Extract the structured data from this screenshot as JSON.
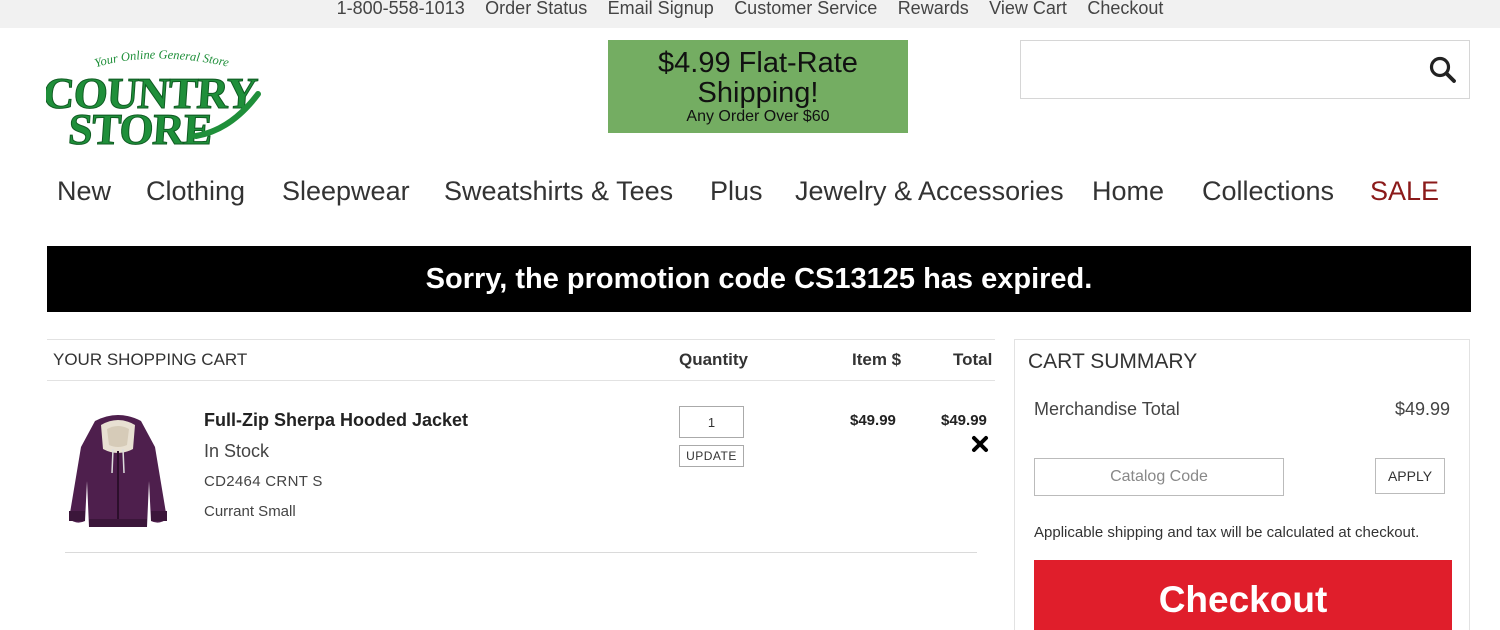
{
  "topbar": {
    "links": [
      "1-800-558-1013",
      "Order Status",
      "Email Signup",
      "Customer Service",
      "Rewards",
      "View Cart",
      "Checkout"
    ]
  },
  "logo": {
    "tagline": "Your Online General Store",
    "line1": "COUNTRY",
    "line2": "STORE",
    "color": "#1f8f3a"
  },
  "promo": {
    "line1": "$4.99 Flat-Rate",
    "line2": "Shipping!",
    "line3": "Any Order Over $60",
    "color": "#74ad62"
  },
  "search": {
    "placeholder": "",
    "icon": "search-icon"
  },
  "nav": {
    "items": [
      "New",
      "Clothing",
      "Sleepwear",
      "Sweatshirts & Tees",
      "Plus",
      "Jewelry & Accessories",
      "Home",
      "Collections",
      "SALE"
    ],
    "sale_color": "#8b1a1a"
  },
  "alert": {
    "message": "Sorry, the promotion code CS13125 has expired."
  },
  "cart": {
    "title": "YOUR SHOPPING CART",
    "col_quantity": "Quantity",
    "col_item": "Item $",
    "col_total": "Total",
    "items": [
      {
        "name": "Full-Zip Sherpa Hooded Jacket",
        "stock": "In Stock",
        "sku": "CD2464 CRNT S",
        "variant": "Currant Small",
        "quantity": "1",
        "update_label": "UPDATE",
        "item_price": "$49.99",
        "total": "$49.99",
        "image_color": "#4e1f4d"
      }
    ]
  },
  "summary": {
    "title": "CART SUMMARY",
    "merch_label": "Merchandise Total",
    "merch_value": "$49.99",
    "catalog_placeholder": "Catalog Code",
    "apply_label": "APPLY",
    "note": "Applicable shipping and tax will be calculated at checkout.",
    "checkout_label": "Checkout",
    "checkout_color": "#e01e2b"
  }
}
